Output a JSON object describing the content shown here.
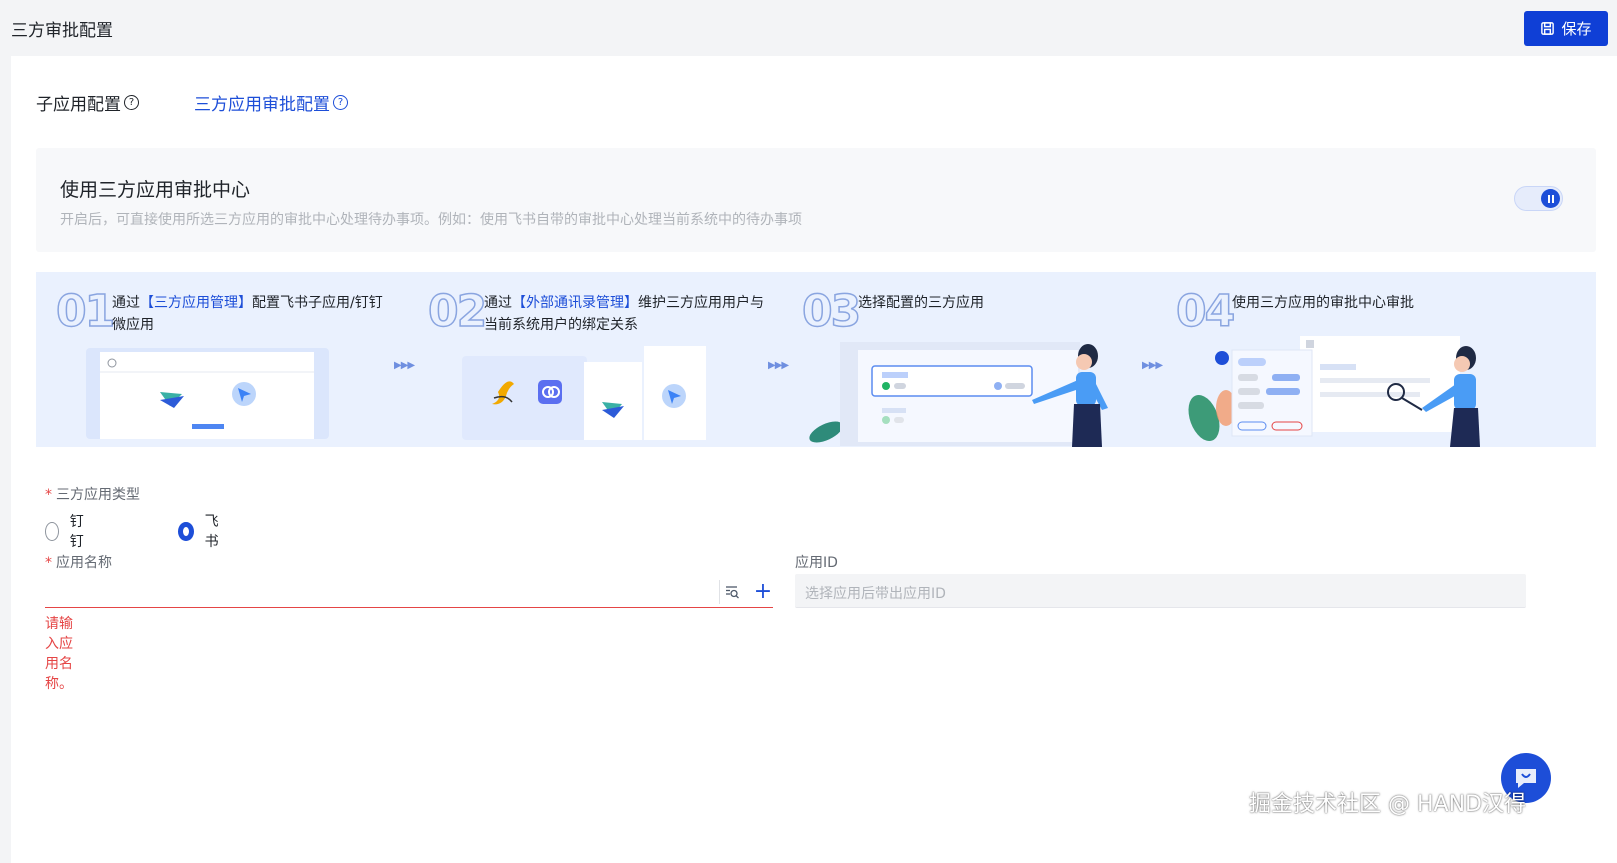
{
  "header": {
    "title": "三方审批配置",
    "save_label": "保存"
  },
  "tabs": [
    {
      "label": "子应用配置",
      "active": false
    },
    {
      "label": "三方应用审批配置",
      "active": true
    }
  ],
  "switch_section": {
    "title": "使用三方应用审批中心",
    "description": "开启后，可直接使用所选三方应用的审批中心处理待办事项。例如：使用飞书自带的审批中心处理当前系统中的待办事项",
    "enabled": true
  },
  "steps": [
    {
      "number": "01",
      "before": "通过",
      "highlight": "【三方应用管理】",
      "after": "配置飞书子应用/钉钉微应用"
    },
    {
      "number": "02",
      "before": "通过",
      "highlight": "【外部通讯录管理】",
      "after": "维护三方应用用户与当前系统用户的绑定关系"
    },
    {
      "number": "03",
      "before": "选择配置的三方应用",
      "highlight": "",
      "after": ""
    },
    {
      "number": "04",
      "before": "使用三方应用的审批中心审批",
      "highlight": "",
      "after": ""
    }
  ],
  "form": {
    "app_type": {
      "required_mark": "*",
      "label": "三方应用类型",
      "options": [
        {
          "label": "钉钉",
          "selected": false
        },
        {
          "label": "飞书",
          "selected": true
        }
      ]
    },
    "app_name": {
      "required_mark": "*",
      "label": "应用名称",
      "value": "",
      "error": "请输入应用名称。"
    },
    "app_id": {
      "label": "应用ID",
      "placeholder": "选择应用后带出应用ID"
    }
  },
  "watermark": "掘金技术社区 @ HAND汉得",
  "colors": {
    "primary": "#1d4ed8",
    "error": "#e54545",
    "save_button": "#0f3fd6"
  }
}
